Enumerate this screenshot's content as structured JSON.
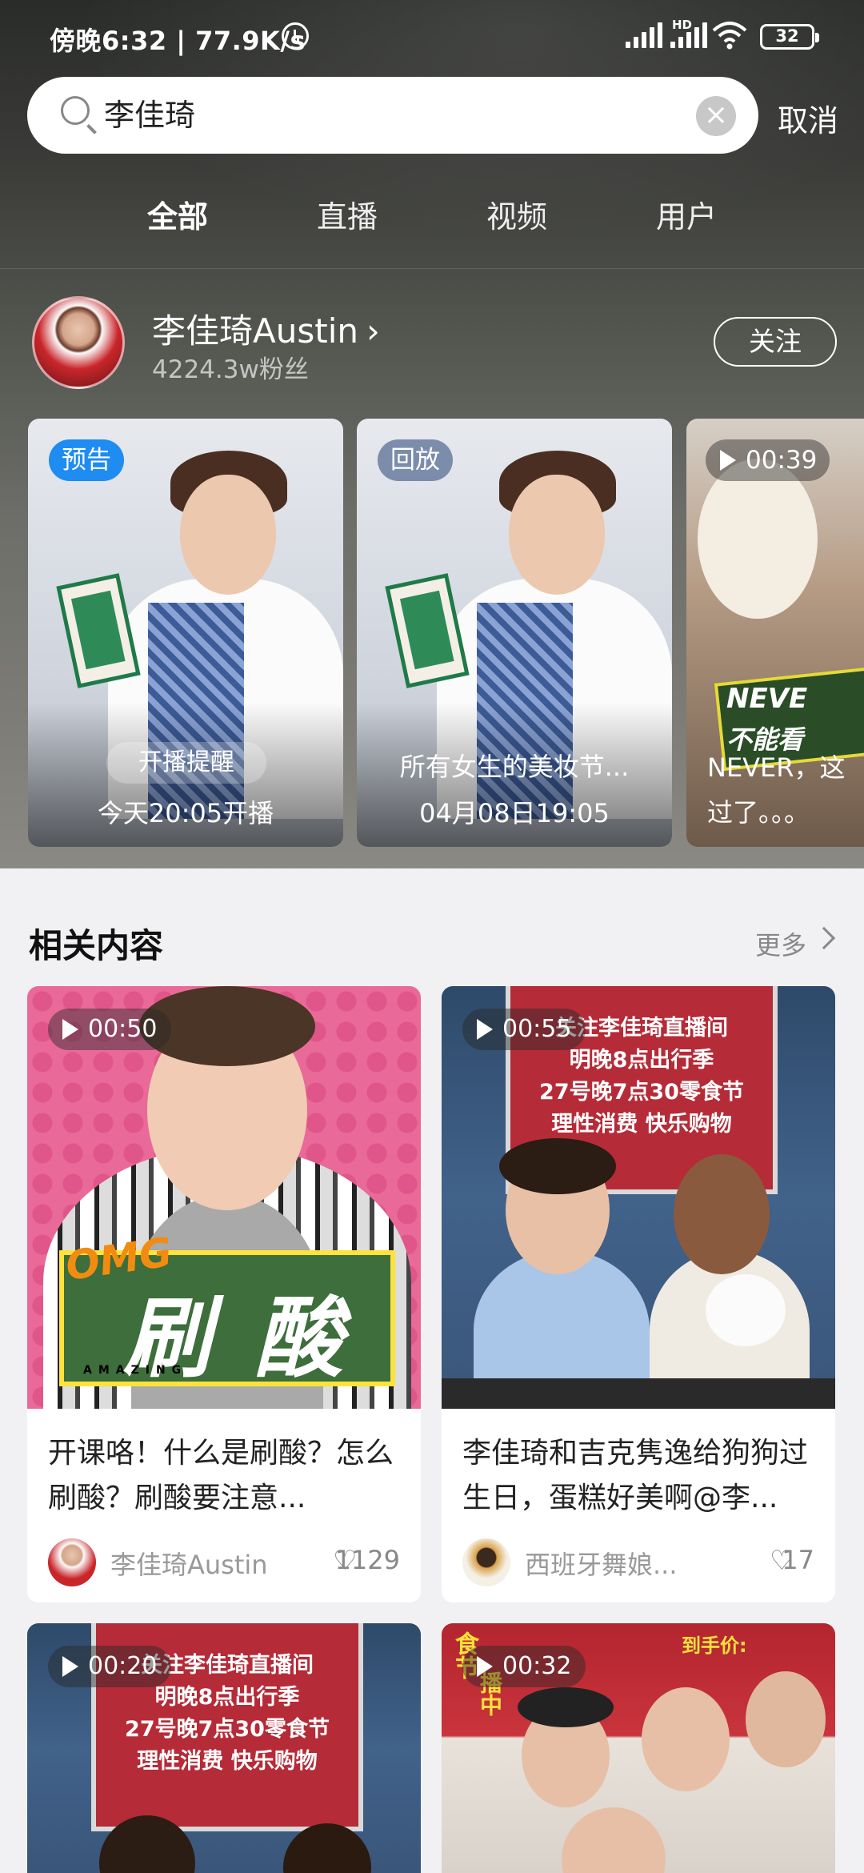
{
  "status_bar": {
    "time_speed": "傍晚6:32 | 77.9K/s",
    "network": "HD",
    "battery": "32"
  },
  "search": {
    "query": "李佳琦",
    "cancel": "取消"
  },
  "tabs": [
    "全部",
    "直播",
    "视频",
    "用户"
  ],
  "active_tab": "全部",
  "profile": {
    "name": "李佳琦Austin",
    "fans": "4224.3w粉丝",
    "follow": "关注"
  },
  "live_cards": [
    {
      "badge": "预告",
      "remind": "开播提醒",
      "title": "今天20:05开播"
    },
    {
      "badge": "回放",
      "title": "所有女生的美妆节...",
      "time": "04月08日19:05"
    },
    {
      "duration": "00:39",
      "title_line1": "NEVER，这",
      "title_line2": "过了。。。",
      "thumb_text": "NEVE",
      "thumb_sub": "不能看"
    }
  ],
  "related": {
    "heading": "相关内容",
    "more": "更多"
  },
  "videos": [
    {
      "duration": "00:50",
      "thumb_text": "刷 酸",
      "thumb_logo": "OMG",
      "thumb_sub": "AMAZING",
      "title": "开课咯！什么是刷酸？怎么刷酸？刷酸要注意...",
      "author": "李佳琦Austin",
      "likes": "1129"
    },
    {
      "duration": "00:55",
      "thumb_lines": [
        "关注李佳琦直播间",
        "明晚8点出行季",
        "27号晚7点30零食节",
        "理性消费 快乐购物"
      ],
      "title": "李佳琦和吉克隽逸给狗狗过生日，蛋糕好美啊@李...",
      "author": "西班牙舞娘...",
      "likes": "17"
    },
    {
      "duration": "00:20",
      "thumb_lines": [
        "关注李佳琦直播间",
        "明晚8点出行季",
        "27号晚7点30零食节",
        "理性消费 快乐购物"
      ]
    },
    {
      "duration": "00:32",
      "thumb_lines": [
        "到手价:",
        "食节",
        "播中"
      ]
    }
  ],
  "colors": {
    "badge_blue": "#1e8cf0",
    "accent_green": "#3d6e3b",
    "omg_orange": "#f28c10",
    "red_board": "#b52b37"
  }
}
